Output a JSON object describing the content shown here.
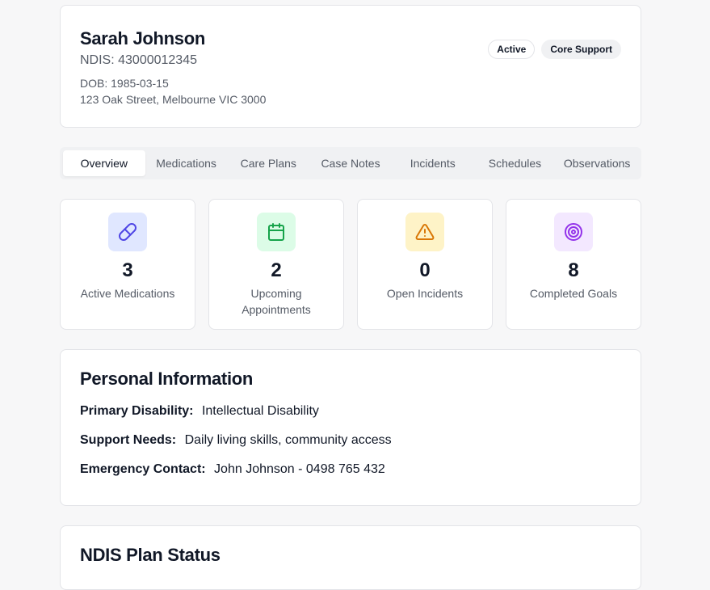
{
  "client": {
    "name": "Sarah Johnson",
    "ndis": "NDIS: 43000012345",
    "dob": "DOB: 1985-03-15",
    "address": "123 Oak Street, Melbourne VIC 3000",
    "badges": {
      "status": "Active",
      "plan_type": "Core Support"
    }
  },
  "tabs": [
    {
      "label": "Overview",
      "active": true
    },
    {
      "label": "Medications",
      "active": false
    },
    {
      "label": "Care Plans",
      "active": false
    },
    {
      "label": "Case Notes",
      "active": false
    },
    {
      "label": "Incidents",
      "active": false
    },
    {
      "label": "Schedules",
      "active": false
    },
    {
      "label": "Observations",
      "active": false
    }
  ],
  "stats": [
    {
      "icon": "pill-icon",
      "value": "3",
      "label": "Active Medications",
      "color": "#4f46e5",
      "bg": "#e0e7ff"
    },
    {
      "icon": "calendar-icon",
      "value": "2",
      "label": "Upcoming Appointments",
      "color": "#16a34a",
      "bg": "#dcfce7"
    },
    {
      "icon": "warning-icon",
      "value": "0",
      "label": "Open Incidents",
      "color": "#d97706",
      "bg": "#fef3c7"
    },
    {
      "icon": "target-icon",
      "value": "8",
      "label": "Completed Goals",
      "color": "#9333ea",
      "bg": "#f3e8ff"
    }
  ],
  "personal_info": {
    "title": "Personal Information",
    "rows": [
      {
        "key": "Primary Disability:",
        "value": "Intellectual Disability"
      },
      {
        "key": "Support Needs:",
        "value": "Daily living skills, community access"
      },
      {
        "key": "Emergency Contact:",
        "value": "John Johnson - 0498 765 432"
      }
    ]
  },
  "plan_status": {
    "title": "NDIS Plan Status"
  }
}
